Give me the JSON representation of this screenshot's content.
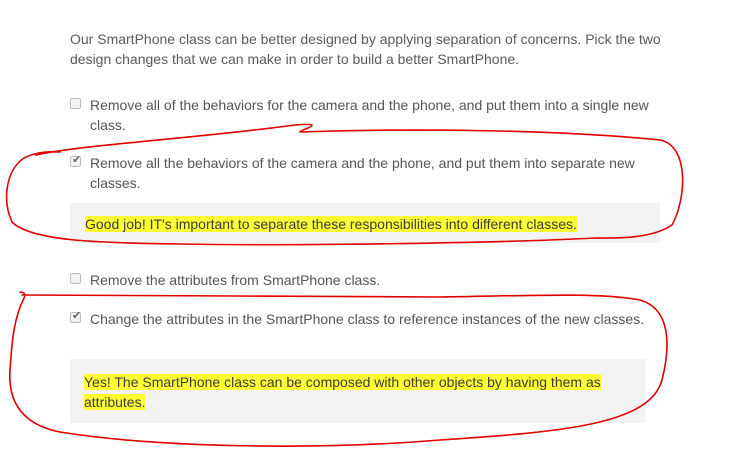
{
  "question": {
    "text": "Our SmartPhone class can be better designed by applying separation of concerns. Pick the two design changes that we can make in order to build a better SmartPhone."
  },
  "options": [
    {
      "label": "Remove all of the behaviors for the camera and the phone, and put them into a single new class.",
      "checked": false
    },
    {
      "label": "Remove all the behaviors of the camera and the phone, and put them into separate new classes.",
      "checked": true,
      "feedback": "Good job! IT's important to separate these responsibilities into different classes."
    },
    {
      "label": "Remove the attributes from SmartPhone class.",
      "checked": false
    },
    {
      "label": "Change the attributes in the SmartPhone class to reference instances of the new classes.",
      "checked": true,
      "feedback": "Yes! The SmartPhone class can be composed with other objects by having them as attributes."
    }
  ],
  "colors": {
    "highlight": "#ffff33",
    "annotation_ink": "#e00000",
    "feedback_bg": "#f3f3f3"
  }
}
